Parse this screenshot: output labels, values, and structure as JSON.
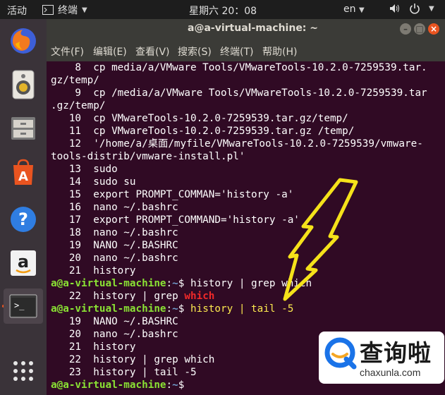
{
  "topbar": {
    "activities": "活动",
    "app_name": "终端",
    "clock": "星期六 20：08",
    "lang": "en"
  },
  "window": {
    "title": "a@a-virtual-machine: ~",
    "menu": [
      "文件(F)",
      "编辑(E)",
      "查看(V)",
      "搜索(S)",
      "终端(T)",
      "帮助(H)"
    ]
  },
  "terminal": {
    "lines": [
      "    8  cp media/a/VMware Tools/VMwareTools-10.2.0-7259539.tar.",
      "gz/temp/",
      "    9  cp /media/a/VMware Tools/VMwareTools-10.2.0-7259539.tar",
      ".gz/temp/",
      "   10  cp VMwareTools-10.2.0-7259539.tar.gz/temp/",
      "   11  cp VMwareTools-10.2.0-7259539.tar.gz /temp/",
      "   12  '/home/a/桌面/myfile/VMwareTools-10.2.0-7259539/vmware-",
      "tools-distrib/vmware-install.pl'",
      "   13  sudo",
      "   14  sudo su",
      "   15  export PROMPT_COMMAN='history -a'",
      "   16  nano ~/.bashrc",
      "   17  export PROMPT_COMMAND='history -a'",
      "   18  nano ~/.bashrc",
      "   19  NANO ~/.BASHRC",
      "   20  nano ~/.bashrc",
      "   21  history"
    ],
    "prompt_user": "a@a-virtual-machine",
    "prompt_path": "~",
    "prompt_sep": ":",
    "prompt_end": "$ ",
    "cmd1": "history | grep which",
    "grep_result_prefix": "   22  history | grep ",
    "grep_result_match": "which",
    "cmd2": "history | tail -5",
    "tail_lines": [
      "   19  NANO ~/.BASHRC",
      "   20  nano ~/.bashrc",
      "   21  history",
      "   22  history | grep which",
      "   23  history | tail -5"
    ]
  },
  "watermark": {
    "cn": "查询啦",
    "en": "chaxunla.com"
  },
  "icons": {
    "dock": [
      "firefox-icon",
      "rhythmbox-icon",
      "files-icon",
      "software-icon",
      "help-icon",
      "amazon-icon",
      "terminal-icon",
      "apps-grid-icon"
    ]
  },
  "colors": {
    "terminal_bg": "#300a24",
    "prompt_user": "#8ae234",
    "prompt_path": "#729fcf",
    "match": "#ef2929",
    "annotation_arrow": "#f5e21a"
  }
}
